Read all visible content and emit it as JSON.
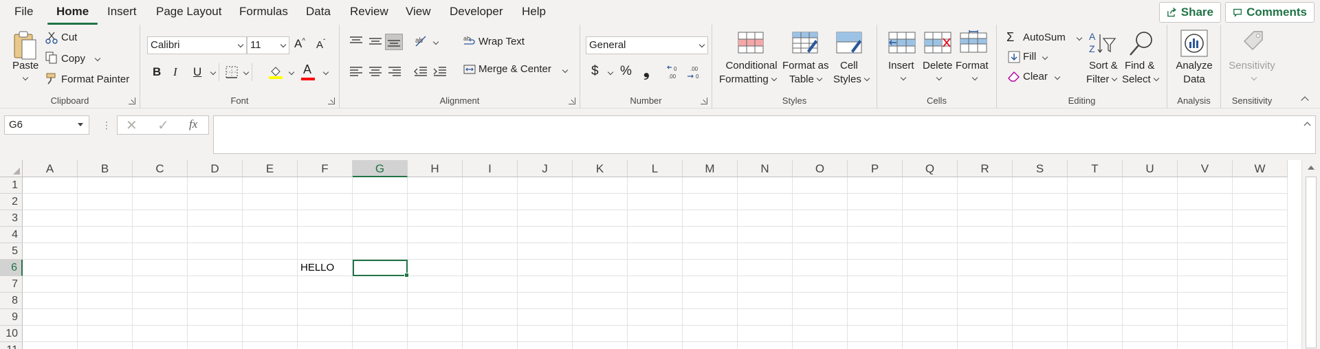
{
  "tabs": [
    "File",
    "Home",
    "Insert",
    "Page Layout",
    "Formulas",
    "Data",
    "Review",
    "View",
    "Developer",
    "Help"
  ],
  "active_tab": "Home",
  "share_label": "Share",
  "comments_label": "Comments",
  "clipboard": {
    "paste": "Paste",
    "cut": "Cut",
    "copy": "Copy",
    "format_painter": "Format Painter",
    "label": "Clipboard"
  },
  "font": {
    "name": "Calibri",
    "size": "11",
    "bold": "B",
    "italic": "I",
    "underline": "U",
    "label": "Font",
    "grow": "A",
    "shrink": "A"
  },
  "alignment": {
    "wrap": "Wrap Text",
    "merge": "Merge & Center",
    "label": "Alignment"
  },
  "number": {
    "format": "General",
    "currency": "$",
    "percent": "%",
    "comma": "❟",
    "inc_dec": "←0 .00",
    "dec_dec": ".00 →0",
    "label": "Number"
  },
  "styles": {
    "cond1": "Conditional",
    "cond2": "Formatting",
    "table1": "Format as",
    "table2": "Table",
    "cell1": "Cell",
    "cell2": "Styles",
    "label": "Styles"
  },
  "cells": {
    "insert": "Insert",
    "delete": "Delete",
    "format": "Format",
    "label": "Cells"
  },
  "editing": {
    "autosum": "AutoSum",
    "fill": "Fill",
    "clear": "Clear",
    "sort1": "Sort &",
    "sort2": "Filter",
    "find1": "Find &",
    "find2": "Select",
    "label": "Editing"
  },
  "analysis": {
    "analyze1": "Analyze",
    "analyze2": "Data",
    "label": "Analysis"
  },
  "sensitivity": {
    "btn": "Sensitivity",
    "label": "Sensitivity"
  },
  "formula_bar": {
    "name_box": "G6",
    "fx": "fx",
    "value": ""
  },
  "columns": [
    "A",
    "B",
    "C",
    "D",
    "E",
    "F",
    "G",
    "H",
    "I",
    "J",
    "K",
    "L",
    "M",
    "N",
    "O",
    "P",
    "Q",
    "R",
    "S",
    "T",
    "U",
    "V",
    "W"
  ],
  "rows": [
    "1",
    "2",
    "3",
    "4",
    "5",
    "6",
    "7",
    "8",
    "9",
    "10",
    "11"
  ],
  "selected_cell": "G6",
  "cells_data": {
    "F6": "HELLO"
  },
  "colors": {
    "accent": "#217346",
    "fill_yellow": "#ffff00",
    "font_red": "#ff0000"
  }
}
